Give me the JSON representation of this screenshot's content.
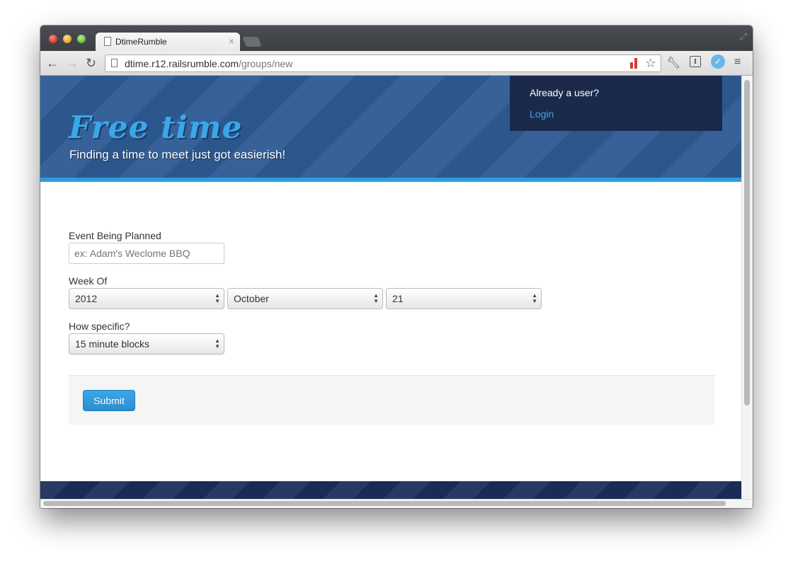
{
  "browser": {
    "tab_title": "DtimeRumble",
    "tab_close": "×",
    "url_host": "dtime.r12.railsrumble.com",
    "url_path": "/groups/new"
  },
  "header": {
    "logo_text": "Free time",
    "tagline": "Finding a time to meet just got easierish!",
    "login_prompt": "Already a user?",
    "login_link": "Login"
  },
  "form": {
    "event_label": "Event Being Planned",
    "event_placeholder": "ex: Adam's Weclome BBQ",
    "week_label": "Week Of",
    "year_value": "2012",
    "month_value": "October",
    "day_value": "21",
    "specific_label": "How specific?",
    "specific_value": "15 minute blocks",
    "submit_label": "Submit"
  },
  "colors": {
    "header_bg": "#2e5c95",
    "accent": "#2f9be0",
    "login_box_bg": "#1b2a4a",
    "footer_bg": "#1b2f5a"
  },
  "icons": [
    "page-icon",
    "back-icon",
    "forward-icon",
    "reload-icon",
    "bar-chart-icon",
    "star-icon",
    "wrench-icon",
    "reader-icon",
    "extension-icon",
    "menu-icon",
    "fullscreen-icon"
  ]
}
